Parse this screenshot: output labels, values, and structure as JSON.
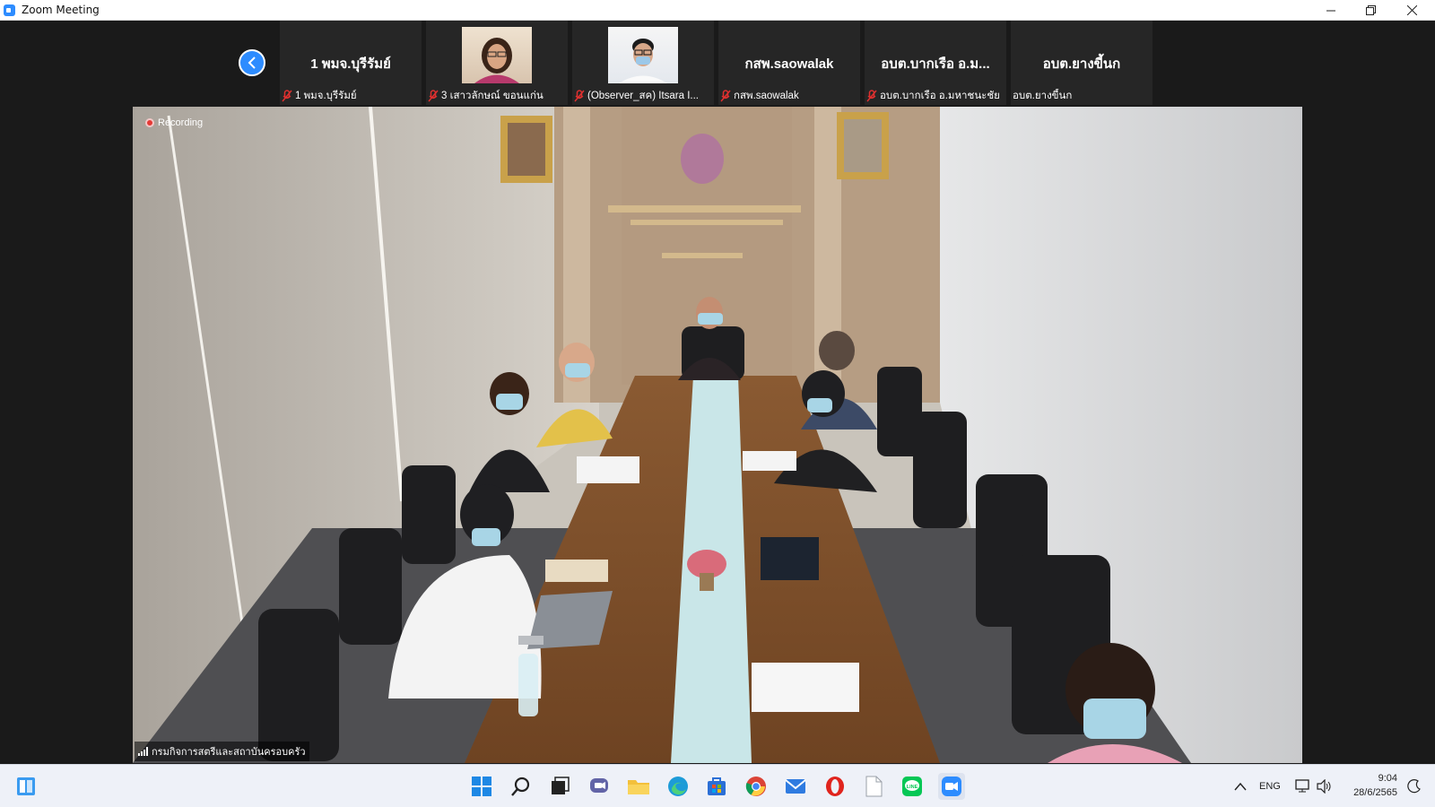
{
  "window": {
    "title": "Zoom Meeting",
    "controls": [
      "minimize",
      "maximize",
      "close"
    ]
  },
  "participants": [
    {
      "display_name": "1 พมจ.บุรีรัมย์",
      "label": "1 พมจ.บุรีรัมย์",
      "muted": true,
      "video": false
    },
    {
      "display_name": "",
      "label": "3 เสาวลักษณ์ ขอนแก่น",
      "muted": true,
      "video": true
    },
    {
      "display_name": "",
      "label": "(Observer_สค) Itsara I...",
      "muted": true,
      "video": true
    },
    {
      "display_name": "กสพ.saowalak",
      "label": "กสพ.saowalak",
      "muted": true,
      "video": false
    },
    {
      "display_name": "อบต.บากเรือ อ.ม...",
      "label": "อบต.บากเรือ อ.มหาชนะชัย",
      "muted": true,
      "video": false
    },
    {
      "display_name": "อบต.ยางขี้นก",
      "label": "อบต.ยางขี้นก",
      "muted": false,
      "video": false
    }
  ],
  "main_video": {
    "recording_label": "Recording",
    "speaker_label": "กรมกิจการสตรีและสถาบันครอบครัว"
  },
  "taskbar": {
    "apps": [
      "widgets-icon",
      "start-icon",
      "search-icon",
      "task-view-icon",
      "teams-chat-icon",
      "file-explorer-icon",
      "edge-icon",
      "store-icon",
      "chrome-icon",
      "mail-icon",
      "opera-icon",
      "document-icon",
      "line-icon",
      "zoom-icon"
    ],
    "language": "ENG",
    "time": "9:04",
    "date": "28/6/2565"
  },
  "colors": {
    "accent": "#2d8cff",
    "mute_red": "#e0302f",
    "strip_bg": "#1a1a1a",
    "tile_bg": "#262626"
  }
}
